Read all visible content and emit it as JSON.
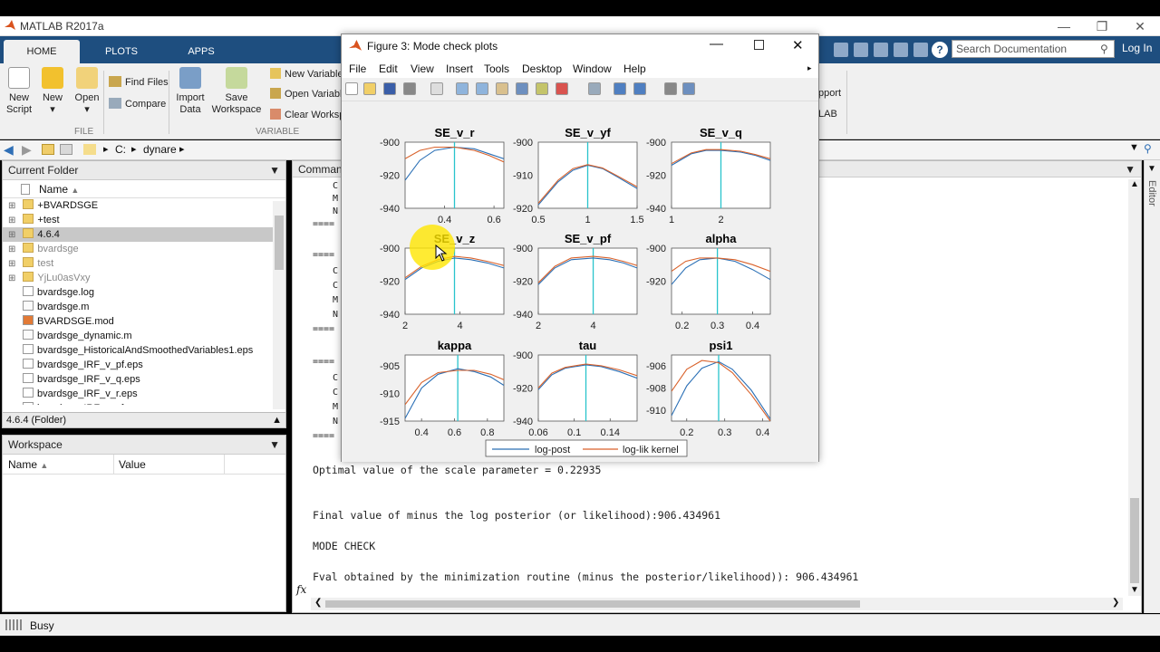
{
  "app": {
    "title": "MATLAB R2017a"
  },
  "tabs": [
    "HOME",
    "PLOTS",
    "APPS"
  ],
  "search": {
    "placeholder": "Search Documentation"
  },
  "login": "Log In",
  "ribbon": {
    "new_script": [
      "New",
      "Script"
    ],
    "new": "New",
    "open": "Open",
    "find_files": "Find Files",
    "compare": "Compare",
    "import": [
      "Import",
      "Data"
    ],
    "save_ws": [
      "Save",
      "Workspace"
    ],
    "new_variable": "New Variable",
    "open_variable": "Open Variable",
    "clear_workspace": "Clear Workspace",
    "group_file": "FILE",
    "group_variable": "VARIABLE",
    "right_pport": "pport",
    "right_lab": "LAB"
  },
  "address": {
    "drive": "C:",
    "folder": "dynare"
  },
  "current_folder": {
    "title": "Current Folder",
    "col_name": "Name",
    "items": [
      {
        "name": "+BVARDSGE",
        "type": "folder",
        "dim": false
      },
      {
        "name": "+test",
        "type": "folder",
        "dim": false
      },
      {
        "name": "4.6.4",
        "type": "folder",
        "dim": false,
        "selected": true
      },
      {
        "name": "bvardsge",
        "type": "folder",
        "dim": true
      },
      {
        "name": "test",
        "type": "folder",
        "dim": true
      },
      {
        "name": "YjLu0asVxy",
        "type": "folder",
        "dim": true
      },
      {
        "name": "bvardsge.log",
        "type": "file",
        "dim": false
      },
      {
        "name": "bvardsge.m",
        "type": "mfile",
        "dim": false
      },
      {
        "name": "BVARDSGE.mod",
        "type": "mod",
        "dim": false
      },
      {
        "name": "bvardsge_dynamic.m",
        "type": "mfile",
        "dim": false
      },
      {
        "name": "bvardsge_HistoricalAndSmoothedVariables1.eps",
        "type": "file",
        "dim": false
      },
      {
        "name": "bvardsge_IRF_v_pf.eps",
        "type": "file",
        "dim": false
      },
      {
        "name": "bvardsge_IRF_v_q.eps",
        "type": "file",
        "dim": false
      },
      {
        "name": "bvardsge_IRF_v_r.eps",
        "type": "file",
        "dim": false
      },
      {
        "name": "bvardsge_IRF_v_yf.eps",
        "type": "file",
        "dim": false
      }
    ],
    "details": "4.6.4  (Folder)"
  },
  "workspace": {
    "title": "Workspace",
    "col_name": "Name",
    "col_value": "Value"
  },
  "command_window": {
    "title": "Command Window",
    "partial_left": [
      "C",
      "M",
      "N",
      "====",
      "====",
      "C",
      "C",
      "M",
      "N",
      "====",
      "====",
      "C",
      "C",
      "M",
      "N",
      "===="
    ],
    "lines": [
      "Optimal value of the scale parameter = 0.22935",
      "",
      "",
      "Final value of minus the log posterior (or likelihood):906.434961",
      "",
      "MODE CHECK",
      "",
      "Fval obtained by the minimization routine (minus the posterior/likelihood)): 906.434961"
    ],
    "prompt": "fx"
  },
  "figure": {
    "title": "Figure 3: Mode check plots",
    "menu": [
      "File",
      "Edit",
      "View",
      "Insert",
      "Tools",
      "Desktop",
      "Window",
      "Help"
    ],
    "legend": [
      "log-post",
      "log-lik kernel"
    ],
    "colors": {
      "post": "#2a6fb5",
      "lik": "#d9622b",
      "mode": "#29c4cc"
    }
  },
  "chart_data": [
    {
      "type": "line",
      "title": "SE_v_r",
      "xticks": [
        "0.4",
        "0.6"
      ],
      "yticks": [
        "-900",
        "-920",
        "-940"
      ],
      "xlim": [
        0.24,
        0.64
      ],
      "ylim": [
        -940,
        -900
      ],
      "mode_x": 0.44,
      "series": [
        {
          "name": "log-post",
          "x": [
            0.24,
            0.3,
            0.36,
            0.44,
            0.52,
            0.58,
            0.64
          ],
          "y": [
            -923,
            -911,
            -905,
            -903,
            -904,
            -907,
            -910
          ]
        },
        {
          "name": "log-lik kernel",
          "x": [
            0.24,
            0.3,
            0.36,
            0.44,
            0.52,
            0.58,
            0.64
          ],
          "y": [
            -910,
            -905,
            -903,
            -903,
            -905,
            -908,
            -912
          ]
        }
      ]
    },
    {
      "type": "line",
      "title": "SE_v_yf",
      "xticks": [
        "0.5",
        "1",
        "1.5"
      ],
      "yticks": [
        "-900",
        "-910",
        "-920"
      ],
      "xlim": [
        0.5,
        1.5
      ],
      "ylim": [
        -920,
        -900
      ],
      "mode_x": 1.0,
      "series": [
        {
          "name": "log-post",
          "x": [
            0.5,
            0.7,
            0.85,
            1.0,
            1.15,
            1.3,
            1.5
          ],
          "y": [
            -919,
            -912,
            -908.5,
            -907,
            -908,
            -910.5,
            -914
          ]
        },
        {
          "name": "log-lik kernel",
          "x": [
            0.5,
            0.7,
            0.85,
            1.0,
            1.15,
            1.3,
            1.5
          ],
          "y": [
            -918.5,
            -911.5,
            -908,
            -906.8,
            -907.8,
            -910.2,
            -913.5
          ]
        }
      ]
    },
    {
      "type": "line",
      "title": "SE_v_q",
      "xticks": [
        "1",
        "2"
      ],
      "yticks": [
        "-900",
        "-920",
        "-940"
      ],
      "xlim": [
        1,
        3
      ],
      "ylim": [
        -940,
        -900
      ],
      "mode_x": 2.0,
      "series": [
        {
          "name": "log-post",
          "x": [
            1,
            1.4,
            1.7,
            2.0,
            2.4,
            2.7,
            3.0
          ],
          "y": [
            -914,
            -907,
            -905,
            -905,
            -906,
            -908,
            -911
          ]
        },
        {
          "name": "log-lik kernel",
          "x": [
            1,
            1.4,
            1.7,
            2.0,
            2.4,
            2.7,
            3.0
          ],
          "y": [
            -913,
            -906.5,
            -904.5,
            -904.5,
            -905.5,
            -907.5,
            -910
          ]
        }
      ]
    },
    {
      "type": "line",
      "title": "SE_v_z",
      "xticks": [
        "2",
        "4"
      ],
      "yticks": [
        "-900",
        "-920",
        "-940"
      ],
      "xlim": [
        2,
        5.6
      ],
      "ylim": [
        -940,
        -900
      ],
      "mode_x": 3.8,
      "series": [
        {
          "name": "log-post",
          "x": [
            2,
            2.6,
            3.2,
            3.8,
            4.4,
            5.0,
            5.6
          ],
          "y": [
            -919,
            -912,
            -908,
            -906,
            -907,
            -909,
            -912
          ]
        },
        {
          "name": "log-lik kernel",
          "x": [
            2,
            2.6,
            3.2,
            3.8,
            4.4,
            5.0,
            5.6
          ],
          "y": [
            -918,
            -911,
            -907,
            -905,
            -906,
            -908,
            -910.5
          ]
        }
      ]
    },
    {
      "type": "line",
      "title": "SE_v_pf",
      "xticks": [
        "2",
        "4"
      ],
      "yticks": [
        "-900",
        "-920",
        "-940"
      ],
      "xlim": [
        2,
        5.6
      ],
      "ylim": [
        -940,
        -900
      ],
      "mode_x": 4.0,
      "series": [
        {
          "name": "log-post",
          "x": [
            2,
            2.6,
            3.2,
            4.0,
            4.6,
            5.1,
            5.6
          ],
          "y": [
            -922,
            -912,
            -907,
            -906,
            -907,
            -909,
            -912
          ]
        },
        {
          "name": "log-lik kernel",
          "x": [
            2,
            2.6,
            3.2,
            4.0,
            4.6,
            5.1,
            5.6
          ],
          "y": [
            -921,
            -911,
            -906,
            -905,
            -906,
            -908,
            -910.5
          ]
        }
      ]
    },
    {
      "type": "line",
      "title": "alpha",
      "xticks": [
        "0.2",
        "0.3",
        "0.4"
      ],
      "yticks": [
        "-900",
        "-920"
      ],
      "xlim": [
        0.17,
        0.45
      ],
      "ylim": [
        -940,
        -900
      ],
      "mode_x": 0.3,
      "series": [
        {
          "name": "log-post",
          "x": [
            0.17,
            0.21,
            0.25,
            0.3,
            0.35,
            0.4,
            0.45
          ],
          "y": [
            -922,
            -912,
            -907,
            -906,
            -908,
            -913,
            -919
          ]
        },
        {
          "name": "log-lik kernel",
          "x": [
            0.17,
            0.21,
            0.25,
            0.3,
            0.35,
            0.4,
            0.45
          ],
          "y": [
            -914,
            -908,
            -906,
            -906,
            -907,
            -910,
            -914
          ]
        }
      ]
    },
    {
      "type": "line",
      "title": "kappa",
      "xticks": [
        "0.4",
        "0.6",
        "0.8"
      ],
      "yticks": [
        "-905",
        "-910",
        "-915"
      ],
      "xlim": [
        0.3,
        0.9
      ],
      "ylim": [
        -915,
        -903
      ],
      "mode_x": 0.62,
      "series": [
        {
          "name": "log-post",
          "x": [
            0.3,
            0.4,
            0.5,
            0.62,
            0.72,
            0.82,
            0.9
          ],
          "y": [
            -914.5,
            -909,
            -906.5,
            -905.5,
            -906,
            -907,
            -908.5
          ]
        },
        {
          "name": "log-lik kernel",
          "x": [
            0.3,
            0.4,
            0.5,
            0.62,
            0.72,
            0.82,
            0.9
          ],
          "y": [
            -912,
            -908,
            -906.2,
            -905.8,
            -905.8,
            -906.5,
            -907.5
          ]
        }
      ]
    },
    {
      "type": "line",
      "title": "tau",
      "xticks": [
        "0.06",
        "0.1",
        "0.14"
      ],
      "yticks": [
        "-900",
        "-920",
        "-940"
      ],
      "xlim": [
        0.06,
        0.17
      ],
      "ylim": [
        -940,
        -900
      ],
      "mode_x": 0.113,
      "series": [
        {
          "name": "log-post",
          "x": [
            0.06,
            0.075,
            0.09,
            0.113,
            0.13,
            0.15,
            0.17
          ],
          "y": [
            -921,
            -912,
            -908,
            -906,
            -907,
            -910,
            -914
          ]
        },
        {
          "name": "log-lik kernel",
          "x": [
            0.06,
            0.075,
            0.09,
            0.113,
            0.13,
            0.15,
            0.17
          ],
          "y": [
            -920,
            -911,
            -907.5,
            -905.5,
            -906.5,
            -909,
            -912.5
          ]
        }
      ]
    },
    {
      "type": "line",
      "title": "psi1",
      "xticks": [
        "0.2",
        "0.3",
        "0.4"
      ],
      "yticks": [
        "-906",
        "-908",
        "-910"
      ],
      "xlim": [
        0.16,
        0.42
      ],
      "ylim": [
        -911,
        -905
      ],
      "mode_x": 0.284,
      "series": [
        {
          "name": "log-post",
          "x": [
            0.16,
            0.2,
            0.24,
            0.284,
            0.32,
            0.37,
            0.42
          ],
          "y": [
            -910.5,
            -907.8,
            -906.2,
            -905.6,
            -906.3,
            -908.2,
            -910.8
          ]
        },
        {
          "name": "log-lik kernel",
          "x": [
            0.16,
            0.2,
            0.24,
            0.284,
            0.32,
            0.37,
            0.42
          ],
          "y": [
            -908.3,
            -906.3,
            -905.5,
            -905.7,
            -906.6,
            -908.6,
            -911
          ]
        }
      ]
    }
  ],
  "status": "Busy"
}
